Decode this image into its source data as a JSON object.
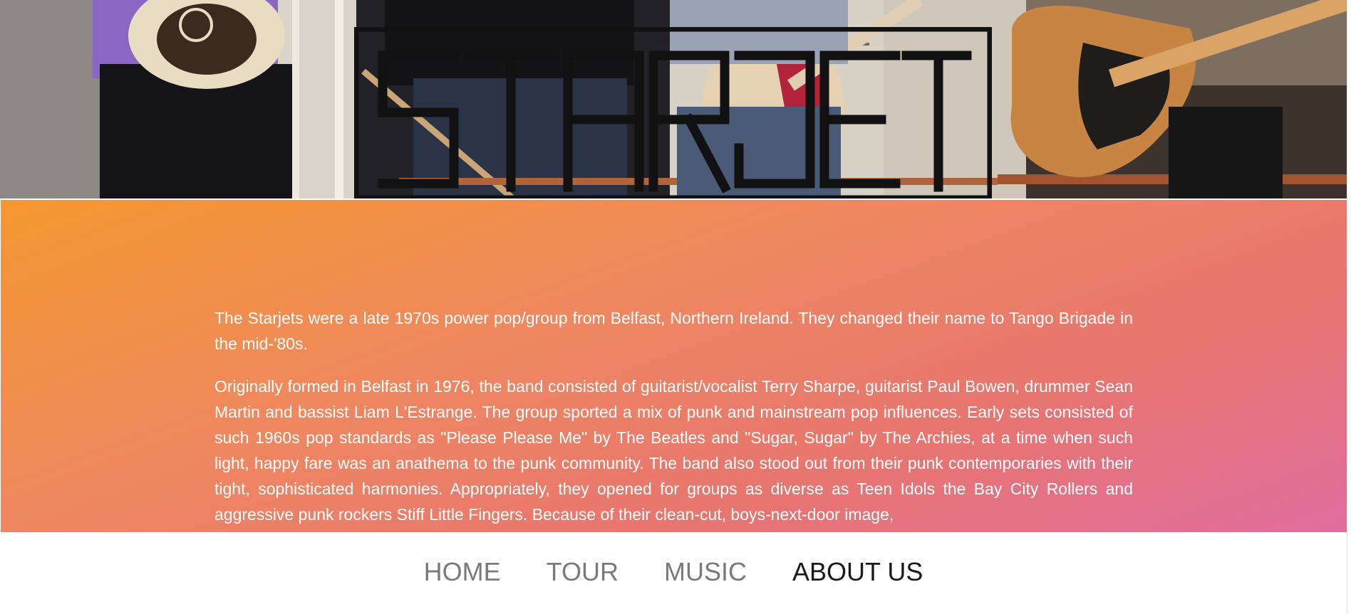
{
  "site": {
    "band_name_logo": "STARJETS"
  },
  "about": {
    "paragraphs": [
      "The Starjets were a late 1970s power pop/group from Belfast, Northern Ireland. They changed their name to Tango Brigade in the mid-'80s.",
      "Originally formed in Belfast in 1976, the band consisted of guitarist/vocalist Terry Sharpe, guitarist Paul Bowen, drummer Sean Martin and bassist Liam L'Estrange. The group sported a mix of punk and mainstream pop influences. Early sets consisted of such 1960s pop standards as \"Please Please Me\" by The Beatles and \"Sugar, Sugar\" by The Archies, at a time when such light, happy fare was an anathema to the punk community. The band also stood out from their punk contemporaries with their tight, sophisticated harmonies. Appropriately, they opened for groups as diverse as Teen Idols the Bay City Rollers and aggressive punk rockers Stiff Little Fingers. Because of their clean-cut, boys-next-door image,"
    ]
  },
  "nav": {
    "items": [
      {
        "label": "HOME",
        "active": false
      },
      {
        "label": "TOUR",
        "active": false
      },
      {
        "label": "MUSIC",
        "active": false
      },
      {
        "label": "ABOUT US",
        "active": true
      }
    ]
  },
  "colors": {
    "gradient_start": "#f69831",
    "gradient_end": "#e16d9f",
    "nav_inactive": "#7a7a7a",
    "nav_active": "#1a1a1a",
    "body_text": "#ffffff"
  }
}
